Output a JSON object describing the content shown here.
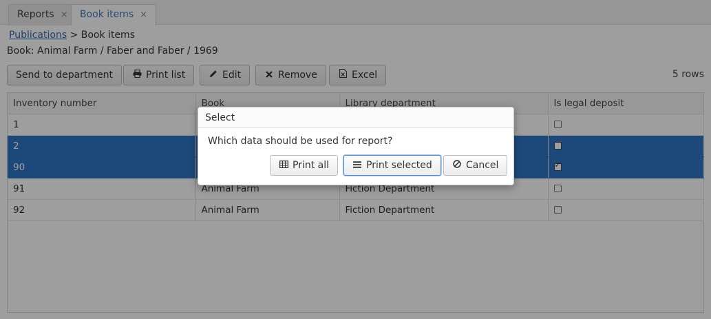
{
  "tabs": [
    {
      "label": "Reports",
      "close": "×",
      "icon": "close-icon"
    },
    {
      "label": "Book items",
      "close": "×",
      "icon": "close-icon"
    }
  ],
  "breadcrumb": {
    "link": "Publications",
    "separator": ">",
    "current": "Book items"
  },
  "subtitle": "Book: Animal Farm / Faber and Faber / 1969",
  "toolbar": {
    "send_label": "Send to department",
    "print_list_label": "Print list",
    "edit_label": "Edit",
    "remove_label": "Remove",
    "excel_label": "Excel",
    "row_count": "5 rows"
  },
  "table": {
    "columns": [
      "Inventory number",
      "Book",
      "Library department",
      "Is legal deposit"
    ],
    "rows": [
      {
        "inventory": "1",
        "book": "",
        "department": "",
        "legal_deposit": false,
        "selected": false
      },
      {
        "inventory": "2",
        "book": "",
        "department": "",
        "legal_deposit": false,
        "selected": true
      },
      {
        "inventory": "90",
        "book": "",
        "department": "",
        "legal_deposit": true,
        "selected": true
      },
      {
        "inventory": "91",
        "book": "Animal Farm",
        "department": "Fiction Department",
        "legal_deposit": false,
        "selected": false
      },
      {
        "inventory": "92",
        "book": "Animal Farm",
        "department": "Fiction Department",
        "legal_deposit": false,
        "selected": false
      }
    ]
  },
  "dialog": {
    "title": "Select",
    "message": "Which data should be used for report?",
    "print_all_label": "Print all",
    "print_selected_label": "Print selected",
    "cancel_label": "Cancel"
  },
  "colors": {
    "selection": "#2f75c6",
    "link": "#2e6ab1",
    "active_tab_text": "#3f7cc0"
  }
}
